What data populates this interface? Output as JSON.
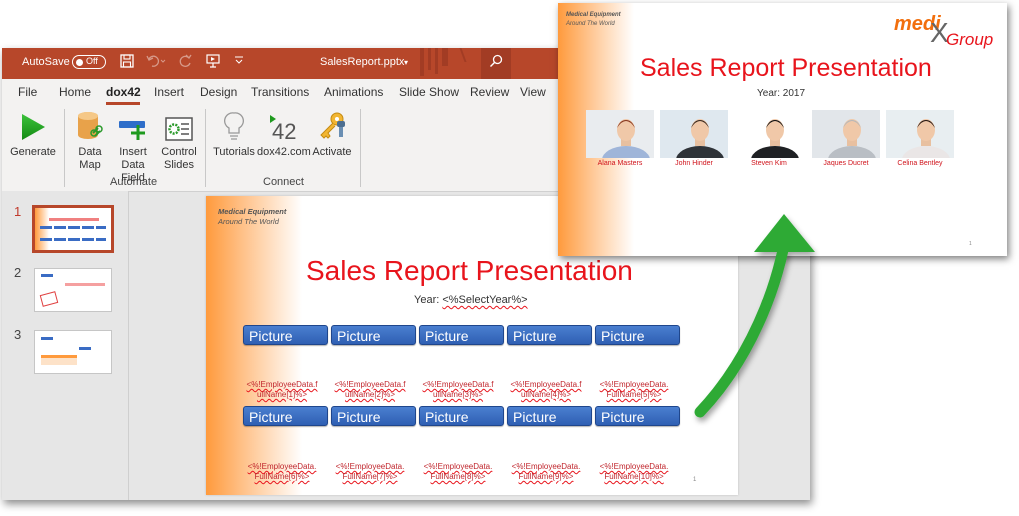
{
  "window": {
    "autosave_label": "AutoSave",
    "autosave_state": "Off",
    "file_name": "SalesReport.pptx",
    "file_name_caret": "▾",
    "titlebar_icons": [
      "save-icon",
      "undo-icon",
      "redo-icon",
      "present-icon",
      "customize-icon",
      "search-icon"
    ]
  },
  "menu": {
    "items": [
      "File",
      "Home",
      "dox42",
      "Insert",
      "Design",
      "Transitions",
      "Animations",
      "Slide Show",
      "Review",
      "View"
    ],
    "active": "dox42"
  },
  "ribbon": {
    "buttons": [
      {
        "label_1": "Generate",
        "label_2": "",
        "icon": "play-icon"
      },
      {
        "label_1": "Data",
        "label_2": "Map",
        "icon": "database-link-icon"
      },
      {
        "label_1": "Insert",
        "label_2": "Data Field",
        "icon": "insert-field-icon"
      },
      {
        "label_1": "Control",
        "label_2": "Slides",
        "icon": "control-slides-icon"
      },
      {
        "label_1": "Tutorials",
        "label_2": "",
        "icon": "lightbulb-icon"
      },
      {
        "label_1": "dox42.com",
        "label_2": "",
        "icon": "dox42-logo-icon"
      },
      {
        "label_1": "Activate",
        "label_2": "",
        "icon": "keys-icon"
      }
    ],
    "groups": [
      "Automate",
      "Connect"
    ]
  },
  "thumbnails": {
    "numbers": [
      "1",
      "2",
      "3"
    ],
    "selected": 1
  },
  "template_slide": {
    "company_line1": "Medical Equipment",
    "company_line2": "Around The World",
    "title": "Sales Report Presentation",
    "year_label": "Year: ",
    "year_field": "<%SelectYear%>",
    "picture_label": "Picture",
    "fields_row1": [
      [
        "<%!EmployeeData.f",
        "ullName[1]%>"
      ],
      [
        "<%!EmployeeData.f",
        "ullName[2]%>"
      ],
      [
        "<%!EmployeeData.f",
        "ullName[3]%>"
      ],
      [
        "<%!EmployeeData.f",
        "ullName[4]%>"
      ],
      [
        "<%!EmployeeData.",
        "FullName[5]%>"
      ]
    ],
    "fields_row2": [
      [
        "<%!EmployeeData.",
        "FullName[6]%>"
      ],
      [
        "<%!EmployeeData.",
        "FullName[7]%>"
      ],
      [
        "<%!EmployeeData.",
        "FullName[8]%>"
      ],
      [
        "<%!EmployeeData.",
        "FullName[9]%>"
      ],
      [
        "<%!EmployeeData.",
        "FullName[10]%>"
      ]
    ],
    "page_number": "1"
  },
  "result_slide": {
    "company_line1": "Medical Equipment",
    "company_line2": "Around The World",
    "logo_part1": "medi",
    "logo_x": "X",
    "logo_part2": "Group",
    "title": "Sales Report Presentation",
    "year": "Year: 2017",
    "employees": [
      "Alana Masters",
      "John Hinder",
      "Steven Kim",
      "Jaques Ducret",
      "Celina Bentley"
    ],
    "page_number": "1"
  },
  "colors": {
    "accent": "#b7472a",
    "title_red": "#e8141c",
    "arrow_green": "#2eaa35",
    "picture_blue": "#3a6cc4",
    "gradient_orange": "#ff9a3c"
  }
}
